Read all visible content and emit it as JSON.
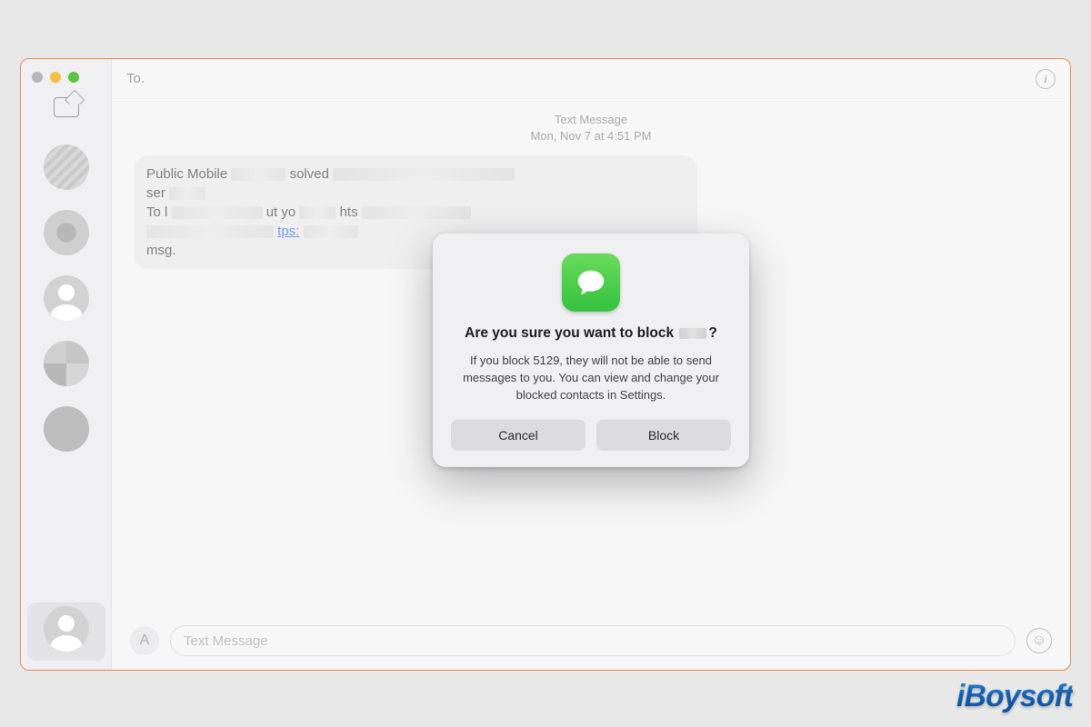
{
  "header": {
    "to_label": "To.",
    "to_value": "",
    "info_glyph": "i"
  },
  "thread": {
    "kind": "Text Message",
    "timestamp": "Mon, Nov 7 at 4:51 PM",
    "bubble": {
      "line1_pre": "Public Mobile ",
      "line1_mid": "solved ",
      "line2_pre": "ser",
      "line3_pre": "To l",
      "line3_mid": "ut yo",
      "line3_post": "hts",
      "link_frag": "tps:",
      "line5": "msg."
    }
  },
  "composer": {
    "placeholder": "Text Message",
    "apps_glyph": "A",
    "emoji_glyph": "☺"
  },
  "modal": {
    "title_prefix": "Are you sure you want to block ",
    "title_suffix": "?",
    "body": "If you block 5129, they will not be able to send messages to you. You can view and change your blocked contacts in Settings.",
    "cancel": "Cancel",
    "block": "Block"
  },
  "watermark": "iBoysoft"
}
